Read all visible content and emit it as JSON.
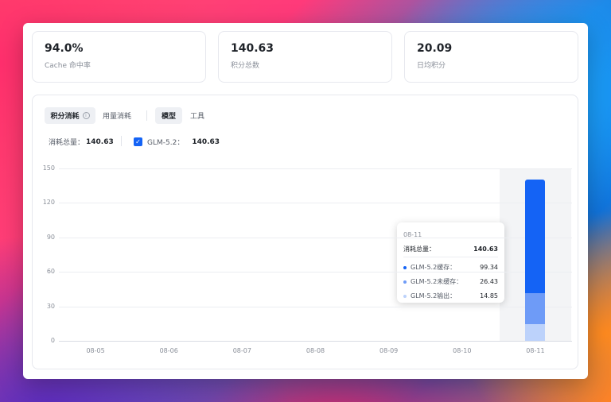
{
  "stats": [
    {
      "value": "94.0%",
      "label": "Cache 命中率"
    },
    {
      "value": "140.63",
      "label": "积分总数"
    },
    {
      "value": "20.09",
      "label": "日均积分"
    }
  ],
  "tabs": {
    "credit": "积分消耗",
    "usage": "用量消耗",
    "model": "模型",
    "tool": "工具"
  },
  "summary": {
    "total_label": "消耗总量：",
    "total_value": "140.63",
    "series_label": "GLM-5.2：",
    "series_value": "140.63"
  },
  "chart_data": {
    "type": "bar",
    "stacked": true,
    "categories": [
      "08-05",
      "08-06",
      "08-07",
      "08-08",
      "08-09",
      "08-10",
      "08-11"
    ],
    "series": [
      {
        "name": "GLM-5.2缓存",
        "values": [
          0,
          0,
          0,
          0,
          0,
          0,
          99.34
        ],
        "color": "#1463f5"
      },
      {
        "name": "GLM-5.2未缓存",
        "values": [
          0,
          0,
          0,
          0,
          0,
          0,
          26.43
        ],
        "color": "#6e9bf7"
      },
      {
        "name": "GLM-5.2输出",
        "values": [
          0,
          0,
          0,
          0,
          0,
          0,
          14.85
        ],
        "color": "#bcd2fb"
      }
    ],
    "y_ticks": [
      "0",
      "30",
      "60",
      "90",
      "120",
      "150"
    ],
    "ylim": [
      0,
      150
    ],
    "grid": true,
    "highlight_category": "08-11"
  },
  "tooltip": {
    "date": "08-11",
    "total_label": "消耗总量：",
    "total_value": "140.63",
    "items": [
      {
        "label": "GLM-5.2缓存：",
        "value": "99.34",
        "color": "#1463f5"
      },
      {
        "label": "GLM-5.2未缓存：",
        "value": "26.43",
        "color": "#6e9bf7"
      },
      {
        "label": "GLM-5.2输出：",
        "value": "14.85",
        "color": "#bcd2fb"
      }
    ]
  }
}
